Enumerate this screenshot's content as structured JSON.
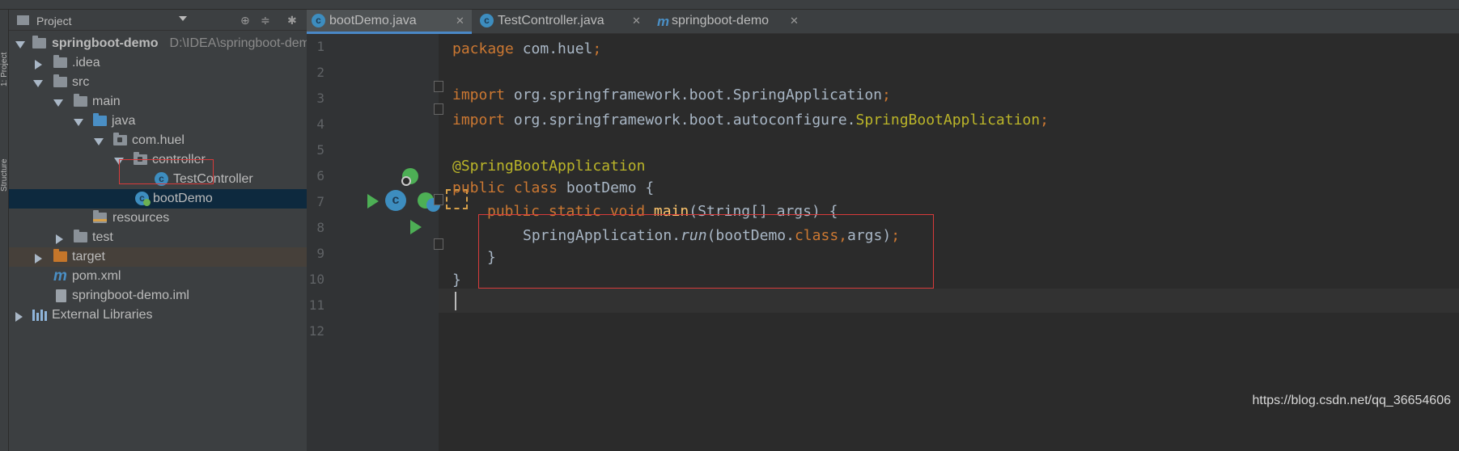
{
  "sidebar_tabs": [
    "1: Project",
    "Structure"
  ],
  "project_panel": {
    "title": "Project",
    "icons": [
      "locate-icon",
      "collapse-all-icon",
      "settings-icon",
      "hide-icon"
    ],
    "tree": [
      {
        "label": "springboot-demo",
        "path": "D:\\IDEA\\springboot-demo",
        "icon": "module-folder",
        "bold": true,
        "expanded": true
      },
      {
        "label": ".idea",
        "icon": "folder",
        "expanded": false
      },
      {
        "label": "src",
        "icon": "folder",
        "expanded": true
      },
      {
        "label": "main",
        "icon": "folder",
        "expanded": true
      },
      {
        "label": "java",
        "icon": "source-folder",
        "expanded": true
      },
      {
        "label": "com.huel",
        "icon": "package",
        "expanded": true
      },
      {
        "label": "controller",
        "icon": "package",
        "expanded": true
      },
      {
        "label": "TestController",
        "icon": "class"
      },
      {
        "label": "bootDemo",
        "icon": "spring-boot-class",
        "selected": true
      },
      {
        "label": "resources",
        "icon": "resources-folder"
      },
      {
        "label": "test",
        "icon": "folder",
        "expanded": false
      },
      {
        "label": "target",
        "icon": "excluded-folder",
        "expanded": false
      },
      {
        "label": "pom.xml",
        "icon": "maven"
      },
      {
        "label": "springboot-demo.iml",
        "icon": "iml-file"
      },
      {
        "label": "External Libraries",
        "icon": "libraries",
        "expanded": false
      }
    ]
  },
  "tabs": [
    {
      "label": "bootDemo.java",
      "active": true,
      "icon": "spring-boot-class-icon"
    },
    {
      "label": "TestController.java",
      "active": false,
      "icon": "class-icon"
    },
    {
      "label": "springboot-demo",
      "active": false,
      "icon": "maven-icon"
    }
  ],
  "editor": {
    "line_numbers": [
      "1",
      "2",
      "3",
      "4",
      "5",
      "6",
      "7",
      "8",
      "9",
      "10",
      "11",
      "12"
    ],
    "code": {
      "l1_kw": "package",
      "l1_rest": " com.huel",
      "l1_semi": ";",
      "l3_kw": "import",
      "l3_rest": " org.springframework.boot.SpringApplication",
      "l3_semi": ";",
      "l4_kw": "import",
      "l4_rest": " org.springframework.boot.autoconfigure.",
      "l4_cls": "SpringBootApplication",
      "l4_semi": ";",
      "l6_ann": "@SpringBootApplication",
      "l7_kw": "public class",
      "l7_rest": " bootDemo {",
      "l8_kw": "public static void",
      "l8_fn": " main",
      "l8_rest": "(String[] args) {",
      "l9_a": "SpringApplication.",
      "l9_run": "run",
      "l9_b": "(bootDemo.",
      "l9_kw": "class",
      "l9_c": ",",
      "l9_d": "args)",
      "l9_semi": ";",
      "l10": "}",
      "l11": "}"
    }
  },
  "watermark": "https://blog.csdn.net/qq_36654606",
  "colors": {
    "keyword": "#cc7832",
    "annotation": "#bbb529",
    "method": "#ffc66d",
    "highlight_box": "#d83b3b",
    "selection": "#0d293e"
  }
}
